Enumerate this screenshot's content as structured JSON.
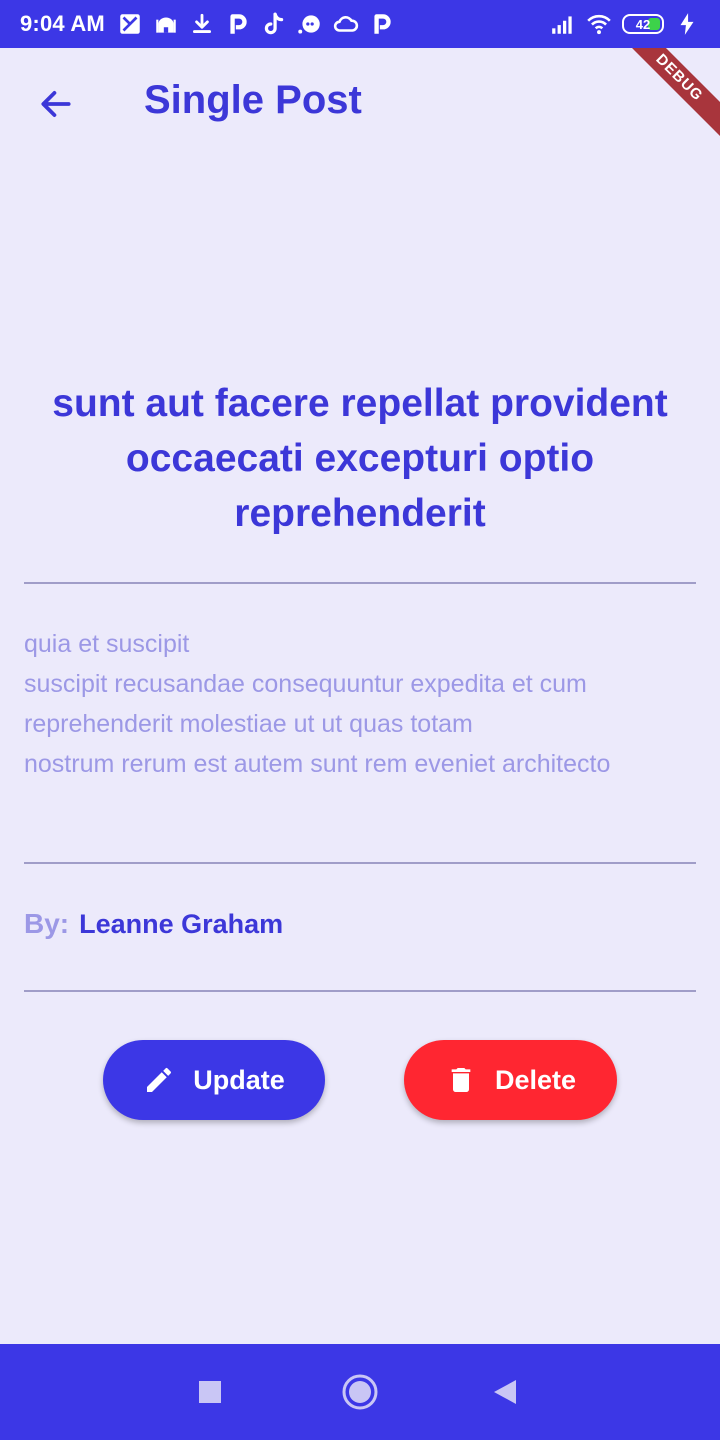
{
  "status_bar": {
    "time": "9:04 AM",
    "battery_level": "42",
    "left_icons": [
      "map-icon",
      "mosque-icon",
      "download-icon",
      "p-app-icon",
      "tiktok-icon",
      "chat-icon",
      "cloud-icon",
      "p-app-icon"
    ],
    "right_icons": [
      "signal-icon",
      "wifi-icon",
      "battery-icon",
      "charging-icon"
    ]
  },
  "debug_banner": {
    "label": "DEBUG"
  },
  "app_bar": {
    "title": "Single Post",
    "back_icon": "arrow-back-icon"
  },
  "post": {
    "title": "sunt aut facere repellat provident occaecati excepturi optio reprehenderit",
    "body": "quia et suscipit\nsuscipit recusandae consequuntur expedita et cum reprehenderit molestiae ut ut quas totam\nnostrum rerum est autem sunt rem eveniet architecto",
    "author_label": "By:",
    "author_name": "Leanne Graham"
  },
  "actions": {
    "update_label": "Update",
    "update_icon": "pencil-icon",
    "delete_label": "Delete",
    "delete_icon": "trash-icon"
  },
  "nav_bar": {
    "items": [
      "recents-icon",
      "home-icon",
      "back-icon"
    ]
  },
  "colors": {
    "primary": "#3C37E6",
    "title_text": "#3C37D8",
    "muted_text": "#9C98E6",
    "background": "#ECEAFB",
    "delete": "#FF2631",
    "divider": "#A09DC8"
  }
}
